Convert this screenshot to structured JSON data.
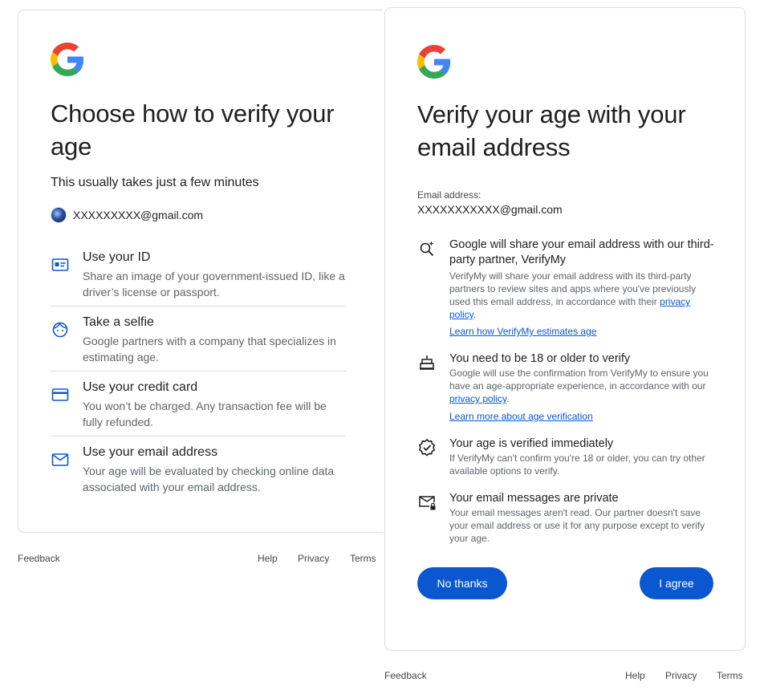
{
  "left_panel": {
    "title": "Choose how to verify your age",
    "subtitle": "This usually takes just a few minutes",
    "account_email": "XXXXXXXXX@gmail.com",
    "options": [
      {
        "icon": "id-card-icon",
        "title": "Use your ID",
        "description": "Share an image of your government-issued ID, like a driver’s license or passport."
      },
      {
        "icon": "face-icon",
        "title": "Take a selfie",
        "description": "Google partners with a company that specializes in estimating age."
      },
      {
        "icon": "credit-card-icon",
        "title": "Use your credit card",
        "description": "You won’t be charged. Any transaction fee will be fully refunded."
      },
      {
        "icon": "mail-icon",
        "title": "Use your email address",
        "description": "Your age will be evaluated by checking online data associated with your email address."
      }
    ],
    "footer": {
      "feedback": "Feedback",
      "help": "Help",
      "privacy": "Privacy",
      "terms": "Terms"
    }
  },
  "right_panel": {
    "title": "Verify your age with your email address",
    "email_label": "Email address:",
    "email_value": "XXXXXXXXXXX@gmail.com",
    "items": [
      {
        "icon": "search-sparkle-icon",
        "title": "Google will share your email address with our third-party partner, VerifyMy",
        "description_pre": "VerifyMy will share your email address with its third-party partners to review sites and apps where you've previously used this email address, in accordance with their ",
        "description_link": "privacy policy",
        "description_post": ".",
        "link": "Learn how VerifyMy estimates age"
      },
      {
        "icon": "cake-icon",
        "title": "You need to be 18 or older to verify",
        "description_pre": "Google will use the confirmation from VerifyMy to ensure you have an age-appropriate experience, in accordance with our ",
        "description_link": "privacy policy",
        "description_post": ".",
        "link": "Learn more about age verification"
      },
      {
        "icon": "verified-check-icon",
        "title": "Your age is verified immediately",
        "description_pre": "If VerifyMy can't confirm you're 18 or older, you can try other available options to verify."
      },
      {
        "icon": "mail-lock-icon",
        "title": "Your email messages are private",
        "description_pre": "Your email messages aren't read. Our partner doesn't save your email address or use it for any purpose except to verify your age."
      }
    ],
    "buttons": {
      "no_thanks": "No thanks",
      "agree": "I agree"
    },
    "footer": {
      "feedback": "Feedback",
      "help": "Help",
      "privacy": "Privacy",
      "terms": "Terms"
    }
  },
  "colors": {
    "primary": "#0b57d0",
    "text": "#1f1f1f",
    "secondary_text": "#5f6368",
    "divider": "#dadce0"
  }
}
